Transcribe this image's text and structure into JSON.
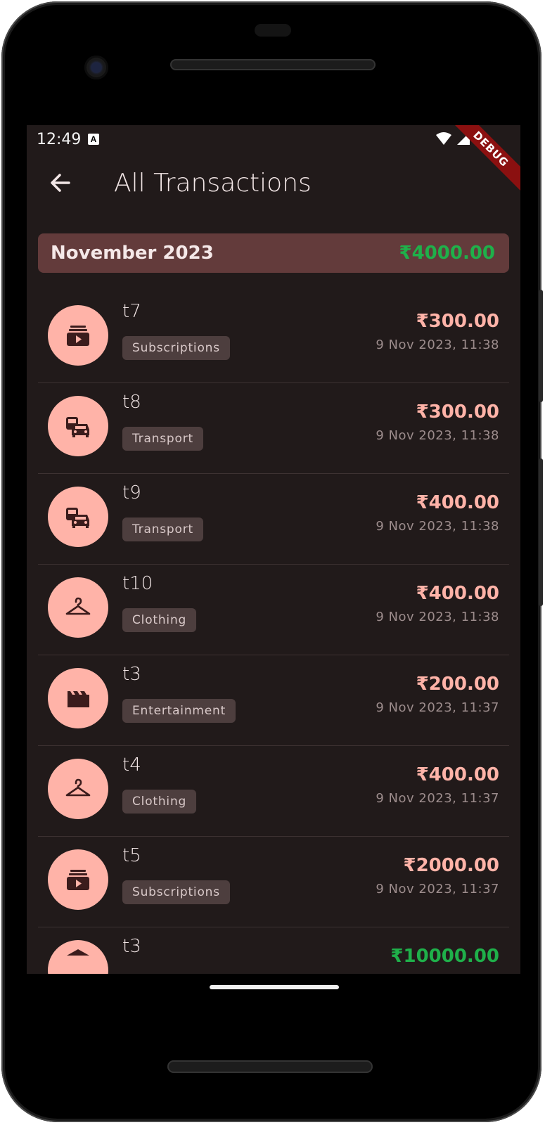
{
  "status_bar": {
    "time": "12:49",
    "notification_glyph": "A",
    "debug_label": "DEBUG"
  },
  "app_bar": {
    "title": "All Transactions",
    "back_icon": "arrow-back-icon"
  },
  "month_summary": {
    "label": "November 2023",
    "total": "₹4000.00",
    "total_color": "#1fb04a"
  },
  "colors": {
    "expense": "#ffb3a8",
    "income": "#1fb04a",
    "background": "#211a1a",
    "card": "#633b3b"
  },
  "transactions": [
    {
      "name": "t7",
      "category": "Subscriptions",
      "amount": "₹300.00",
      "date": "9 Nov 2023, 11:38",
      "icon": "subscriptions-icon",
      "type": "expense"
    },
    {
      "name": "t8",
      "category": "Transport",
      "amount": "₹300.00",
      "date": "9 Nov 2023, 11:38",
      "icon": "transport-icon",
      "type": "expense"
    },
    {
      "name": "t9",
      "category": "Transport",
      "amount": "₹400.00",
      "date": "9 Nov 2023, 11:38",
      "icon": "transport-icon",
      "type": "expense"
    },
    {
      "name": "t10",
      "category": "Clothing",
      "amount": "₹400.00",
      "date": "9 Nov 2023, 11:38",
      "icon": "hanger-icon",
      "type": "expense"
    },
    {
      "name": "t3",
      "category": "Entertainment",
      "amount": "₹200.00",
      "date": "9 Nov 2023, 11:37",
      "icon": "clapperboard-icon",
      "type": "expense"
    },
    {
      "name": "t4",
      "category": "Clothing",
      "amount": "₹400.00",
      "date": "9 Nov 2023, 11:37",
      "icon": "hanger-icon",
      "type": "expense"
    },
    {
      "name": "t5",
      "category": "Subscriptions",
      "amount": "₹2000.00",
      "date": "9 Nov 2023, 11:37",
      "icon": "subscriptions-icon",
      "type": "expense"
    },
    {
      "name": "t3",
      "amount": "₹10000.00",
      "icon": "bank-icon",
      "type": "income"
    }
  ]
}
